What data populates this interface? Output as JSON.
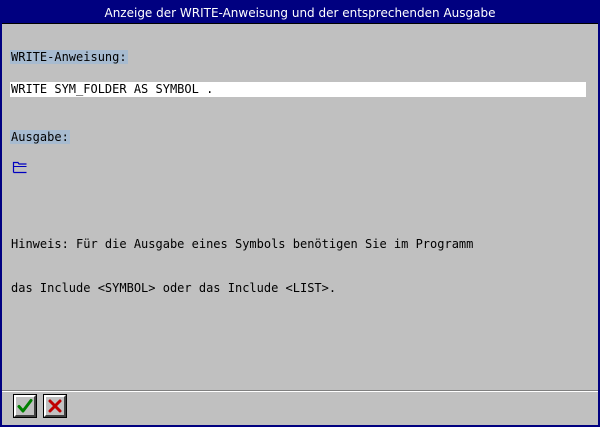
{
  "window": {
    "title": "Anzeige der WRITE-Anweisung und der entsprechenden Ausgabe"
  },
  "content": {
    "write_label": "WRITE-Anweisung:",
    "write_statement": "WRITE SYM_FOLDER AS SYMBOL .",
    "output_label": "Ausgabe:",
    "output_symbol": "folder-icon",
    "hint_lines": [
      "Hinweis: Für die Ausgabe eines Symbols benötigen Sie im Programm",
      "das Include <SYMBOL> oder das Include <LIST>."
    ]
  },
  "toolbar": {
    "buttons": [
      {
        "icon": "checkmark-icon",
        "color": "#008000"
      },
      {
        "icon": "cross-icon",
        "color": "#c00000"
      }
    ]
  },
  "colors": {
    "titlebar": "#000080",
    "background": "#c0c0c0",
    "label_highlight": "#a7bbd0",
    "symbol": "#0000c0"
  }
}
